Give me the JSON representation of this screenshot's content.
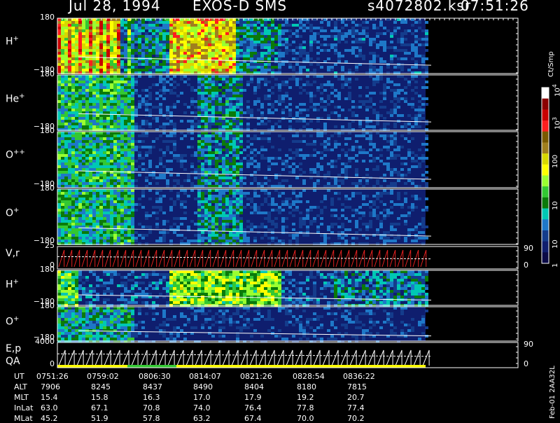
{
  "header": {
    "date": "Jul 28, 1994",
    "instrument": "EXOS-D SMS",
    "file": "s4072802.ksr",
    "time": "07:51:26"
  },
  "colorbar": {
    "unit": "Ct/Smp",
    "ticks": [
      "10",
      "10",
      "100",
      "10",
      "10",
      "1"
    ],
    "exps": [
      "4",
      "3",
      "",
      "",
      "",
      ""
    ],
    "colors": [
      "#ffffff",
      "#8b0000",
      "#c80000",
      "#ff1e1e",
      "#7a5a00",
      "#a07f1e",
      "#d8d800",
      "#ffff00",
      "#9aff30",
      "#33c833",
      "#0a7a0a",
      "#00c8b4",
      "#1e78c8",
      "#143c8c",
      "#0f1e6e",
      "#0a0a46"
    ]
  },
  "side_label": "Feb-01 2AA32L",
  "panels": [
    {
      "id": "hplus1",
      "label": "H",
      "sup": "+",
      "top_tick": "180",
      "bot_tick": "−180"
    },
    {
      "id": "heplus",
      "label": "He",
      "sup": "+",
      "top_tick": "180",
      "bot_tick": "−180"
    },
    {
      "id": "oplusplus",
      "label": "O",
      "sup": "++",
      "top_tick": "180",
      "bot_tick": "−180"
    },
    {
      "id": "oplus1",
      "label": "O",
      "sup": "+",
      "top_tick": "180",
      "bot_tick": "−180"
    },
    {
      "id": "vr",
      "label": "V,r",
      "sup": "",
      "top_tick": "25",
      "bot_tick": "0",
      "right_top": "90",
      "right_bot": "0"
    },
    {
      "id": "hplus2",
      "label": "H",
      "sup": "+",
      "top_tick": "180",
      "bot_tick": "−180"
    },
    {
      "id": "oplus2",
      "label": "O",
      "sup": "+",
      "top_tick": "180",
      "bot_tick": "−180"
    },
    {
      "id": "ep",
      "label": "E,p",
      "sup": "",
      "label2": "QA",
      "top_tick": "4000",
      "bot_tick": "0",
      "right_top": "90",
      "right_bot": "0"
    }
  ],
  "ephemeris": {
    "labels": [
      "UT",
      "ALT",
      "MLT",
      "InLat",
      "MLat"
    ],
    "columns": [
      [
        "0751:26",
        "7906",
        "15.4",
        "63.0",
        "45.2"
      ],
      [
        "0759:02",
        "8245",
        "15.8",
        "67.1",
        "51.9"
      ],
      [
        "0806:30",
        "8437",
        "16.3",
        "70.8",
        "57.8"
      ],
      [
        "0814:07",
        "8490",
        "17.0",
        "74.0",
        "63.2"
      ],
      [
        "0821:26",
        "8404",
        "17.9",
        "76.4",
        "67.4"
      ],
      [
        "0828:54",
        "8180",
        "19.2",
        "77.8",
        "70.0"
      ],
      [
        "0836:22",
        "7815",
        "20.7",
        "77.4",
        "70.2"
      ]
    ]
  },
  "chart_data": {
    "type": "heatmap",
    "title": "Jul 28, 1994   EXOS-D SMS",
    "x_ticks_ut": [
      "0751:26",
      "0759:02",
      "0806:30",
      "0814:07",
      "0821:26",
      "0828:54",
      "0836:22"
    ],
    "panels": [
      {
        "name": "H+",
        "ylim": [
          -180,
          180
        ]
      },
      {
        "name": "He+",
        "ylim": [
          -180,
          180
        ]
      },
      {
        "name": "O++",
        "ylim": [
          -180,
          180
        ]
      },
      {
        "name": "O+",
        "ylim": [
          -180,
          180
        ]
      },
      {
        "name": "V,r",
        "ylim": [
          0,
          25
        ],
        "y2lim": [
          0,
          90
        ]
      },
      {
        "name": "H+",
        "ylim": [
          -180,
          180
        ]
      },
      {
        "name": "O+",
        "ylim": [
          -180,
          180
        ]
      },
      {
        "name": "E,p",
        "ylim": [
          0,
          4000
        ],
        "y2lim": [
          0,
          90
        ]
      }
    ],
    "color_scale": {
      "label": "Ct/Smp",
      "range": [
        1,
        10000
      ],
      "log": true
    }
  }
}
